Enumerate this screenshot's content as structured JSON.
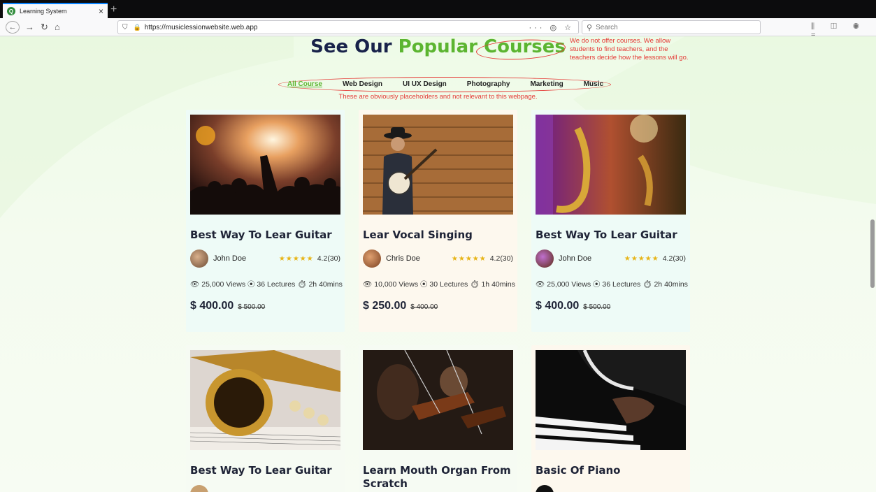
{
  "browser": {
    "tab_title": "Learning System",
    "tab_close": "×",
    "new_tab": "+",
    "url": "https://musiclessionwebsite.web.app",
    "url_tools": "··· ◎ ☆",
    "search_placeholder": "Search"
  },
  "heading": {
    "part1": "See Our ",
    "part2": "Popular Courses"
  },
  "annotations": {
    "courses_note": "We do not offer courses. We allow students to find teachers, and the teachers decide how the lessons will go.",
    "filters_note": "These are obviously placeholders and not relevant to this webpage.",
    "color": "#e53935"
  },
  "filters": [
    "All Course",
    "Web Design",
    "UI UX Design",
    "Photography",
    "Marketing",
    "Music"
  ],
  "cards": [
    {
      "title": "Best Way To Lear Guitar",
      "author": "John Doe",
      "stars": "★★★★★",
      "rating": "4.2(30)",
      "stats": "👁 25,000 Views  ⦿ 36 Lectures  ⏱ 2h 40mins",
      "price": "$ 400.00",
      "old_price": "$ 500.00"
    },
    {
      "title": "Lear Vocal Singing",
      "author": "Chris Doe",
      "stars": "★★★★★",
      "rating": "4.2(30)",
      "stats": "👁 10,000 Views  ⦿ 30 Lectures  ⏱ 1h 40mins",
      "price": "$ 250.00",
      "old_price": "$ 400.00"
    },
    {
      "title": "Best Way To Lear Guitar",
      "author": "John Doe",
      "stars": "★★★★★",
      "rating": "4.2(30)",
      "stats": "👁 25,000 Views  ⦿ 36 Lectures  ⏱ 2h 40mins",
      "price": "$ 400.00",
      "old_price": "$ 500.00"
    },
    {
      "title": "Best Way To Lear Guitar"
    },
    {
      "title": "Learn Mouth Organ From Scratch"
    },
    {
      "title": "Basic Of Piano"
    }
  ],
  "colors": {
    "accent": "#5cb531",
    "heading": "#18224a",
    "star": "#e7b416"
  }
}
